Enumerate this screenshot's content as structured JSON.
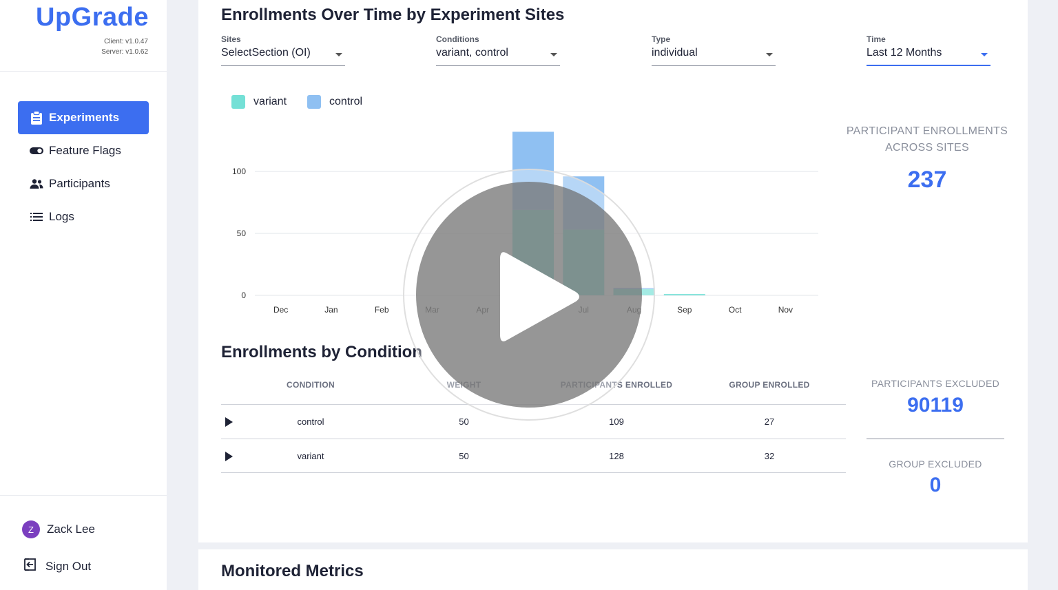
{
  "brand": {
    "name": "UpGrade",
    "client_version": "Client: v1.0.47",
    "server_version": "Server: v1.0.62"
  },
  "nav": [
    {
      "label": "Experiments",
      "icon": "clipboard-icon",
      "active": true
    },
    {
      "label": "Feature Flags",
      "icon": "toggle-icon",
      "active": false
    },
    {
      "label": "Participants",
      "icon": "users-icon",
      "active": false
    },
    {
      "label": "Logs",
      "icon": "list-icon",
      "active": false
    }
  ],
  "user": {
    "initial": "Z",
    "name": "Zack Lee",
    "signout": "Sign Out"
  },
  "section1": {
    "title": "Enrollments Over Time by Experiment Sites"
  },
  "filters": [
    {
      "label": "Sites",
      "value": "SelectSection (OI)"
    },
    {
      "label": "Conditions",
      "value": "variant, control"
    },
    {
      "label": "Type",
      "value": "individual"
    },
    {
      "label": "Time",
      "value": "Last 12 Months"
    }
  ],
  "stats": {
    "enroll_label_1": "PARTICIPANT ENROLLMENTS",
    "enroll_label_2": "ACROSS SITES",
    "enroll_value": "237",
    "excluded_label": "PARTICIPANTS EXCLUDED",
    "excluded_value": "90119",
    "group_excluded_label": "GROUP EXCLUDED",
    "group_excluded_value": "0"
  },
  "section2": {
    "title": "Enrollments by Condition"
  },
  "table": {
    "headers": [
      "CONDITION",
      "WEIGHT",
      "PARTICIPANTS ENROLLED",
      "GROUP ENROLLED"
    ],
    "rows": [
      {
        "condition": "control",
        "weight": "50",
        "participants": "109",
        "group": "27"
      },
      {
        "condition": "variant",
        "weight": "50",
        "participants": "128",
        "group": "32"
      }
    ]
  },
  "section3": {
    "title": "Monitored Metrics"
  },
  "colors": {
    "accent": "#3c6ef0",
    "variant": "#74e0d6",
    "control": "#8fc0f2"
  },
  "chart_data": {
    "type": "bar",
    "stacked": true,
    "title": "",
    "xlabel": "",
    "ylabel": "",
    "ylim": [
      0,
      140
    ],
    "yticks": [
      0,
      50,
      100
    ],
    "categories": [
      "Dec",
      "Jan",
      "Feb",
      "Mar",
      "Apr",
      "Jun",
      "Jul",
      "Aug",
      "Sep",
      "Oct",
      "Nov"
    ],
    "series": [
      {
        "name": "variant",
        "color": "#74e0d6",
        "values": [
          0,
          0,
          0,
          0,
          0,
          69,
          53,
          5,
          1,
          0,
          0
        ]
      },
      {
        "name": "control",
        "color": "#8fc0f2",
        "values": [
          0,
          0,
          0,
          0,
          0,
          63,
          43,
          1,
          0,
          0,
          0
        ]
      }
    ],
    "legend_position": "top-left",
    "grid": true
  }
}
